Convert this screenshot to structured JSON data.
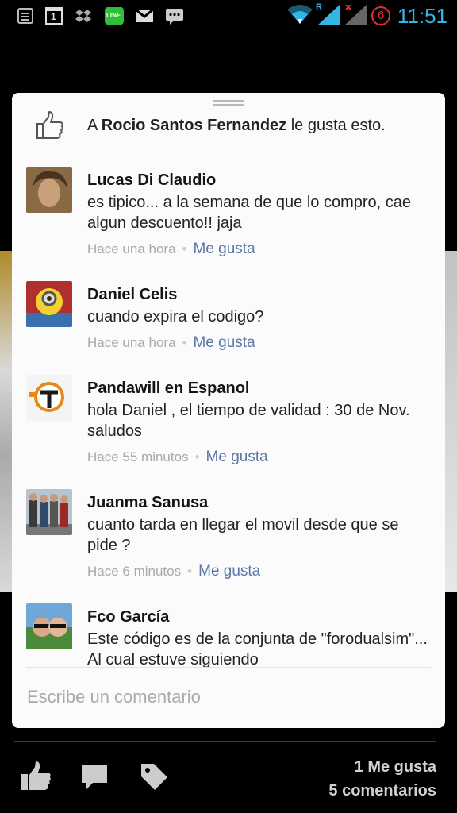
{
  "status_bar": {
    "time": "11:51",
    "battery_badge": "6",
    "roaming_letter": "R",
    "icons": [
      "list-icon",
      "calendar-icon",
      "dropbox-icon",
      "line-app-icon",
      "gmail-icon",
      "message-icon",
      "wifi-icon",
      "signal-icon",
      "signal-no-icon",
      "battery-badge-icon"
    ],
    "calendar_day": "1",
    "line_label": "LINE"
  },
  "likes_sheet": {
    "likes_prefix": "A ",
    "liker_name": "Rocio Santos Fernandez",
    "likes_suffix": " le gusta esto.",
    "comments": [
      {
        "name": "Lucas Di Claudio",
        "text": "es tipico... a la semana de que lo compro, cae algun descuento!! jaja",
        "time": "Hace una hora",
        "like_label": "Me gusta"
      },
      {
        "name": "Daniel Celis",
        "text": "cuando expira el codigo?",
        "time": "Hace una hora",
        "like_label": "Me gusta"
      },
      {
        "name": "Pandawill en Espanol",
        "text": "hola Daniel , el tiempo de validad : 30 de Nov. saludos",
        "time": "Hace 55 minutos",
        "like_label": "Me gusta"
      },
      {
        "name": "Juanma Sanusa",
        "text": "cuanto tarda en llegar el movil desde que se pide ?",
        "time": "Hace 6 minutos",
        "like_label": "Me gusta"
      },
      {
        "name": "Fco García",
        "text": "Este código es de la conjunta de \"forodualsim\"... Al cual estuve siguiendo",
        "time": "",
        "like_label": ""
      }
    ],
    "comment_placeholder": "Escribe un comentario"
  },
  "post_actions": {
    "like_count": "1 Me gusta",
    "comment_count": "5 comentarios",
    "icons": [
      "like-icon",
      "comment-icon",
      "tag-icon"
    ]
  },
  "colors": {
    "accent_time": "#33b5e5",
    "link": "#5b76a8",
    "battery_badge": "#e03030"
  }
}
